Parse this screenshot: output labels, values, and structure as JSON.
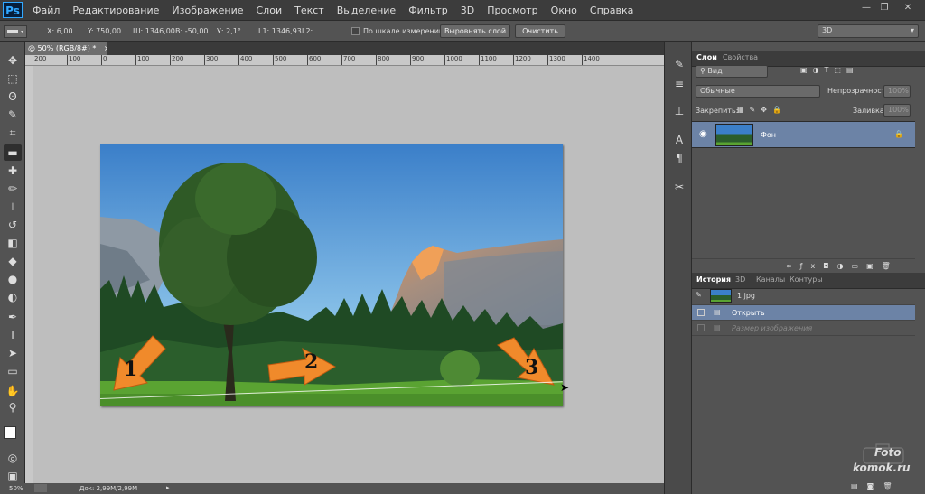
{
  "app": {
    "logo": "Ps"
  },
  "menu": [
    "Файл",
    "Редактирование",
    "Изображение",
    "Слои",
    "Текст",
    "Выделение",
    "Фильтр",
    "3D",
    "Просмотр",
    "Окно",
    "Справка"
  ],
  "window_controls": {
    "minimize": "—",
    "restore": "❐",
    "close": "✕"
  },
  "options": {
    "x": "X: 6,00",
    "y": "Y: 750,00",
    "w": "Ш: 1346,00",
    "h": "В: -50,00",
    "angle": "У: 2,1°",
    "l1": "L1: 1346,93",
    "l2": "L2:",
    "use_scale_label": "По шкале измерений",
    "straighten_label": "Выровнять слой",
    "clear_label": "Очистить",
    "workspace": "3D"
  },
  "document": {
    "tab_title": "@ 50% (RGB/8#) *",
    "tab_close": "×",
    "ruler_labels": [
      "200",
      "100",
      "0",
      "100",
      "200",
      "300",
      "400",
      "500",
      "600",
      "700",
      "800",
      "900",
      "1000",
      "1100",
      "1200",
      "1300",
      "1400"
    ],
    "zoom": "50%",
    "doc_info": "Док: 2,99M/2,99M",
    "annotations": [
      "1",
      "2",
      "3"
    ]
  },
  "layers_panel": {
    "tabs": [
      "Слои",
      "Свойства"
    ],
    "filter_kind": "Вид",
    "blend_mode": "Обычные",
    "opacity_label": "Непрозрачность:",
    "opacity_value": "100%",
    "lock_label": "Закрепить:",
    "fill_label": "Заливка:",
    "fill_value": "100%",
    "layers": [
      {
        "name": "Фон"
      }
    ]
  },
  "history_panel": {
    "tabs": [
      "История",
      "3D",
      "Каналы",
      "Контуры"
    ],
    "snapshot": "1.jpg",
    "items": [
      "Открыть",
      "Размер изображения"
    ]
  },
  "watermark": {
    "line1": "Foto",
    "line2": "komok.ru"
  },
  "colors": {
    "accent_selected": "#6c83a6",
    "ps_blue": "#31a8ff",
    "arrow": "#f08a2b"
  }
}
